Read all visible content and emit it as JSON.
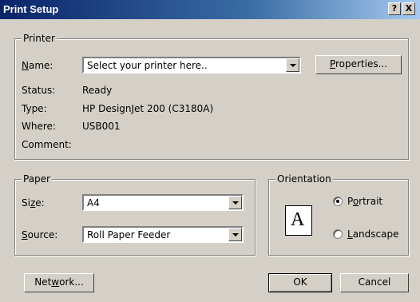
{
  "window": {
    "title": "Print Setup",
    "help_label": "?",
    "close_label": "X"
  },
  "printer": {
    "group_label": "Printer",
    "name_label_accel": "N",
    "name_label_rest": "ame:",
    "selected": "Select your printer here..",
    "properties_accel": "P",
    "properties_rest": "roperties...",
    "status_label": "Status:",
    "status_value": "Ready",
    "type_label": "Type:",
    "type_value": "HP DesignJet 200 (C3180A)",
    "where_label": "Where:",
    "where_value": "USB001",
    "comment_label": "Comment:",
    "comment_value": ""
  },
  "paper": {
    "group_label": "Paper",
    "size_label_pre": "Si",
    "size_label_accel": "z",
    "size_label_post": "e:",
    "size_value": "A4",
    "source_label_accel": "S",
    "source_label_rest": "ource:",
    "source_value": "Roll Paper Feeder"
  },
  "orientation": {
    "group_label": "Orientation",
    "icon_letter": "A",
    "portrait_pre": "P",
    "portrait_accel": "o",
    "portrait_post": "rtrait",
    "landscape_accel": "L",
    "landscape_rest": "andscape",
    "selected": "Portrait"
  },
  "buttons": {
    "network_pre": "Net",
    "network_accel": "w",
    "network_post": "ork...",
    "ok": "OK",
    "cancel": "Cancel"
  }
}
